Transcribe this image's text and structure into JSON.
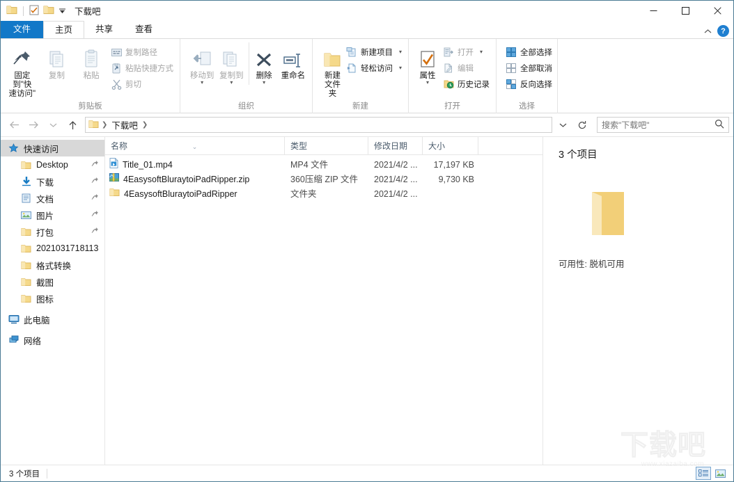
{
  "window": {
    "title": "下载吧",
    "quick_access": [
      "folder-icon",
      "properties-icon",
      "folder-icon",
      "dropdown-arrow"
    ],
    "controls": {
      "minimize": "—",
      "maximize": "□",
      "close": "✕"
    }
  },
  "ribbon": {
    "tabs": [
      {
        "label": "文件",
        "type": "file"
      },
      {
        "label": "主页",
        "type": "active"
      },
      {
        "label": "共享",
        "type": "normal"
      },
      {
        "label": "查看",
        "type": "normal"
      }
    ],
    "collapse_icon": "chevron-up-icon",
    "help_label": "?",
    "groups": [
      {
        "label": "剪贴板",
        "big": [
          {
            "label_line1": "固定到\"快",
            "label_line2": "速访问\"",
            "icon": "pin-icon",
            "dim": false
          },
          {
            "label_line1": "复制",
            "label_line2": "",
            "icon": "copy-icon",
            "dim": true
          },
          {
            "label_line1": "粘贴",
            "label_line2": "",
            "icon": "paste-icon",
            "dim": true
          }
        ],
        "small": [
          {
            "label": "复制路径",
            "icon": "copy-path-icon",
            "dim": true
          },
          {
            "label": "粘贴快捷方式",
            "icon": "paste-shortcut-icon",
            "dim": true
          },
          {
            "label": "剪切",
            "icon": "scissors-icon",
            "dim": true
          }
        ]
      },
      {
        "label": "组织",
        "big": [
          {
            "label_line1": "移动到",
            "label_line2": "",
            "icon": "move-to-icon",
            "dim": true,
            "caret": true
          },
          {
            "label_line1": "复制到",
            "label_line2": "",
            "icon": "copy-to-icon",
            "dim": true,
            "caret": true
          },
          {
            "label_line1": "删除",
            "label_line2": "",
            "icon": "delete-icon",
            "dim": false,
            "caret": true
          },
          {
            "label_line1": "重命名",
            "label_line2": "",
            "icon": "rename-icon",
            "dim": false
          }
        ],
        "small": []
      },
      {
        "label": "新建",
        "big": [
          {
            "label_line1": "新建",
            "label_line2": "文件夹",
            "icon": "new-folder-icon",
            "dim": false
          }
        ],
        "small": [
          {
            "label": "新建项目",
            "icon": "new-item-icon",
            "dim": false,
            "caret": true
          },
          {
            "label": "轻松访问",
            "icon": "easy-access-icon",
            "dim": false,
            "caret": true
          }
        ]
      },
      {
        "label": "打开",
        "big": [
          {
            "label_line1": "属性",
            "label_line2": "",
            "icon": "properties-icon",
            "dim": false,
            "caret": true
          }
        ],
        "small": [
          {
            "label": "打开",
            "icon": "open-icon",
            "dim": true,
            "caret": true
          },
          {
            "label": "编辑",
            "icon": "edit-icon",
            "dim": true
          },
          {
            "label": "历史记录",
            "icon": "history-icon",
            "dim": false
          }
        ]
      },
      {
        "label": "选择",
        "big": [],
        "small": [
          {
            "label": "全部选择",
            "icon": "select-all-icon",
            "dim": false
          },
          {
            "label": "全部取消",
            "icon": "select-none-icon",
            "dim": false
          },
          {
            "label": "反向选择",
            "icon": "invert-selection-icon",
            "dim": false
          }
        ]
      }
    ]
  },
  "address": {
    "back_icon": "arrow-left-icon",
    "forward_icon": "arrow-right-icon",
    "recent_icon": "chevron-down-icon",
    "up_icon": "arrow-up-icon",
    "breadcrumb": [
      "下载吧"
    ],
    "dropdown_icon": "chevron-down-icon",
    "refresh_icon": "refresh-icon"
  },
  "search": {
    "placeholder": "搜索\"下载吧\"",
    "value": "",
    "icon": "search-icon"
  },
  "sidebar": {
    "items": [
      {
        "label": "快速访问",
        "icon": "star-pin-icon",
        "selected": true,
        "pinned": false,
        "indent": false
      },
      {
        "label": "Desktop",
        "icon": "folder-icon",
        "selected": false,
        "pinned": true,
        "indent": true
      },
      {
        "label": "下载",
        "icon": "download-icon",
        "selected": false,
        "pinned": true,
        "indent": true
      },
      {
        "label": "文档",
        "icon": "documents-icon",
        "selected": false,
        "pinned": true,
        "indent": true
      },
      {
        "label": "图片",
        "icon": "pictures-icon",
        "selected": false,
        "pinned": true,
        "indent": true
      },
      {
        "label": "打包",
        "icon": "folder-icon",
        "selected": false,
        "pinned": true,
        "indent": true
      },
      {
        "label": "2021031718113",
        "icon": "folder-icon",
        "selected": false,
        "pinned": false,
        "indent": true
      },
      {
        "label": "格式转换",
        "icon": "folder-icon",
        "selected": false,
        "pinned": false,
        "indent": true
      },
      {
        "label": "截图",
        "icon": "folder-icon",
        "selected": false,
        "pinned": false,
        "indent": true
      },
      {
        "label": "图标",
        "icon": "folder-icon",
        "selected": false,
        "pinned": false,
        "indent": true
      },
      {
        "label": "此电脑",
        "icon": "this-pc-icon",
        "selected": false,
        "pinned": false,
        "indent": false
      },
      {
        "label": "网络",
        "icon": "network-icon",
        "selected": false,
        "pinned": false,
        "indent": false
      }
    ]
  },
  "filelist": {
    "columns": [
      {
        "label": "名称",
        "sorted": true
      },
      {
        "label": "类型",
        "sorted": false
      },
      {
        "label": "修改日期",
        "sorted": false
      },
      {
        "label": "大小",
        "sorted": false
      }
    ],
    "rows": [
      {
        "name": "Title_01.mp4",
        "icon": "mp4-file-icon",
        "type": "MP4 文件",
        "date": "2021/4/2 ...",
        "size": "17,197 KB"
      },
      {
        "name": "4EasysoftBluraytoiPadRipper.zip",
        "icon": "zip-file-icon",
        "type": "360压缩 ZIP 文件",
        "date": "2021/4/2 ...",
        "size": "9,730 KB"
      },
      {
        "name": "4EasysoftBluraytoiPadRipper",
        "icon": "folder-icon",
        "type": "文件夹",
        "date": "2021/4/2 ...",
        "size": ""
      }
    ]
  },
  "details": {
    "title": "3 个项目",
    "icon": "folder-icon",
    "availability": "可用性: 脱机可用"
  },
  "status": {
    "count": "3 个项目",
    "view_list_icon": "list-view-icon",
    "view_thumb_icon": "thumbnail-view-icon"
  },
  "watermark": {
    "text": "下载吧",
    "url": "www.xiazaiba.com"
  }
}
